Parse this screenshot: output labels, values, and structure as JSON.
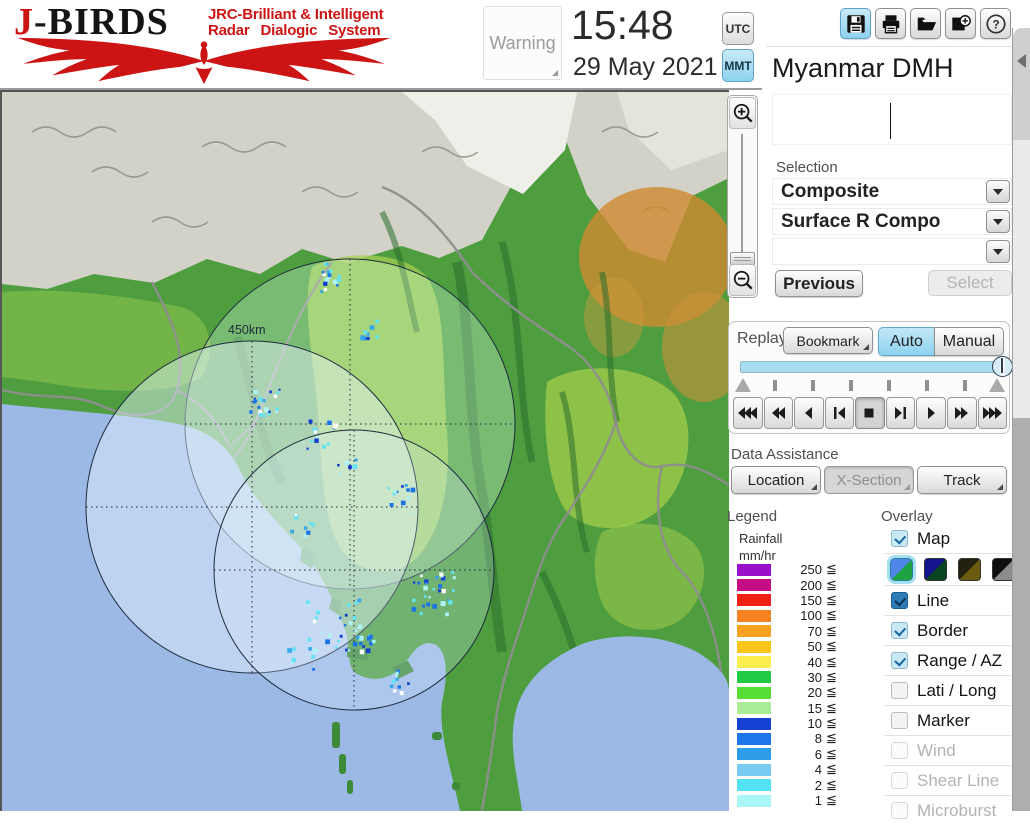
{
  "header": {
    "logo": {
      "title_j": "J",
      "title_rest": "-BIRDS",
      "tagline1": "JRC-Brilliant & Intelligent",
      "tagline2": "Radar Dialogic System",
      "eagle_icon": "red-eagle-icon"
    },
    "warning_label": "Warning",
    "clock": {
      "time": "15:48",
      "date": "29 May 2021"
    },
    "timezone": {
      "utc_label": "UTC",
      "mmt_label": "MMT",
      "selected": "MMT"
    },
    "toolbar_icons": [
      "save-icon",
      "print-icon",
      "open-folder-icon",
      "add-image-icon",
      "help-icon"
    ],
    "help_glyph": "?",
    "site_title": "Myanmar DMH"
  },
  "selection": {
    "label": "Selection",
    "dropdowns": [
      "Composite",
      "Surface R Compo",
      ""
    ],
    "previous_label": "Previous",
    "select_label": "Select"
  },
  "replay": {
    "label": "Replay",
    "bookmark_label": "Bookmark",
    "auto_label": "Auto",
    "manual_label": "Manual",
    "mode_selected": "Auto",
    "slider_position_pct": 100,
    "playback": [
      {
        "name": "fast-rewind",
        "glyph": "L3"
      },
      {
        "name": "rewind",
        "glyph": "L2"
      },
      {
        "name": "play-reverse",
        "glyph": "L1"
      },
      {
        "name": "step-backward",
        "glyph": "BL"
      },
      {
        "name": "stop",
        "glyph": "SQ",
        "pressed": true
      },
      {
        "name": "step-forward",
        "glyph": "RB"
      },
      {
        "name": "play",
        "glyph": "R1"
      },
      {
        "name": "fast-forward",
        "glyph": "R2"
      },
      {
        "name": "skip-forward",
        "glyph": "R3"
      }
    ]
  },
  "data_assistance": {
    "label": "Data Assistance",
    "buttons": [
      {
        "label": "Location",
        "disabled": false
      },
      {
        "label": "X-Section",
        "disabled": true
      },
      {
        "label": "Track",
        "disabled": false
      }
    ]
  },
  "legend": {
    "label": "Legend",
    "title_line1": "Rainfall",
    "title_line2": "mm/hr",
    "lte_symbol": "≦",
    "entries": [
      {
        "value": "250",
        "color": "#9a10c8"
      },
      {
        "value": "200",
        "color": "#c40d83"
      },
      {
        "value": "150",
        "color": "#f02015"
      },
      {
        "value": "100",
        "color": "#f8821e"
      },
      {
        "value": "70",
        "color": "#faa21f"
      },
      {
        "value": "50",
        "color": "#fbc51c"
      },
      {
        "value": "40",
        "color": "#fbee4e"
      },
      {
        "value": "30",
        "color": "#20ca45"
      },
      {
        "value": "20",
        "color": "#58dd36"
      },
      {
        "value": "15",
        "color": "#a9eb97"
      },
      {
        "value": "10",
        "color": "#1542d3"
      },
      {
        "value": "8",
        "color": "#1c76ea"
      },
      {
        "value": "6",
        "color": "#2f9cea"
      },
      {
        "value": "4",
        "color": "#79cbf2"
      },
      {
        "value": "2",
        "color": "#52e2f4"
      },
      {
        "value": "1",
        "color": "#aaf6f6"
      }
    ]
  },
  "overlay": {
    "label": "Overlay",
    "map_styles": [
      {
        "name": "map-style-blue-green",
        "selected": true,
        "top": "#4f86ec",
        "bottom": "#1fa244"
      },
      {
        "name": "map-style-navy-darkgreen",
        "selected": false,
        "top": "#14148c",
        "bottom": "#0b4420"
      },
      {
        "name": "map-style-dark-olive",
        "selected": false,
        "top": "#22200e",
        "bottom": "#6b5c12"
      },
      {
        "name": "map-style-black-gray",
        "selected": false,
        "top": "#0e0e0e",
        "bottom": "#8c8c8c"
      }
    ],
    "items": [
      {
        "label": "Map",
        "checked": true,
        "disabled": false,
        "style": "light"
      },
      {
        "label": "Line",
        "checked": true,
        "disabled": false,
        "style": "dark"
      },
      {
        "label": "Border",
        "checked": true,
        "disabled": false,
        "style": "light"
      },
      {
        "label": "Range / AZ",
        "checked": true,
        "disabled": false,
        "style": "light"
      },
      {
        "label": "Lati / Long",
        "checked": false,
        "disabled": false
      },
      {
        "label": "Marker",
        "checked": false,
        "disabled": false
      },
      {
        "label": "Wind",
        "checked": false,
        "disabled": true
      },
      {
        "label": "Shear Line",
        "checked": false,
        "disabled": true
      },
      {
        "label": "Microburst",
        "checked": false,
        "disabled": true
      }
    ]
  },
  "map": {
    "range_label": "450km",
    "zoom_in_icon": "zoom-in-magnifier-icon",
    "zoom_out_icon": "zoom-out-magnifier-icon"
  },
  "right_edge": {
    "collapse_icon": "collapse-left-arrow-icon"
  },
  "colors": {
    "accent_blue": "#8ed2ee",
    "sea": "#9cb9e6",
    "land": "#4e9e40",
    "logo_red": "#cc1414"
  }
}
